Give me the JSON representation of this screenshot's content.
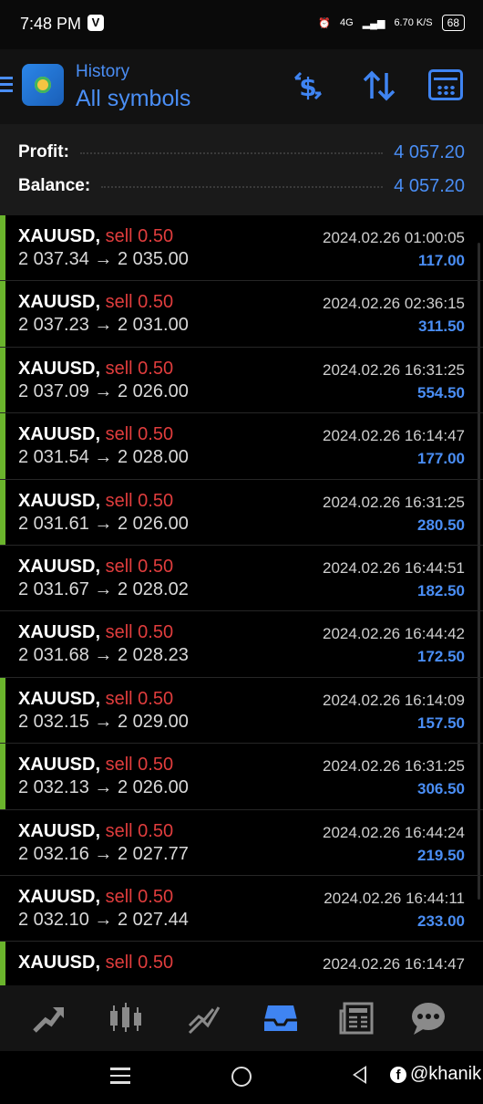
{
  "status_bar": {
    "time": "7:48 PM",
    "v_badge": "V",
    "network": "4G",
    "speed": "6.70 K/S",
    "battery": "68"
  },
  "header": {
    "subtitle": "History",
    "title": "All symbols",
    "accent_color": "#4a8ef5"
  },
  "summary": {
    "profit_label": "Profit:",
    "profit_value": "4 057.20",
    "balance_label": "Balance:",
    "balance_value": "4 057.20"
  },
  "deals": [
    {
      "symbol": "XAUUSD,",
      "type": "sell 0.50",
      "prices": "2 037.34 → 2 035.00",
      "date": "2024.02.26 01:00:05",
      "profit": "117.00",
      "marked": true
    },
    {
      "symbol": "XAUUSD,",
      "type": "sell 0.50",
      "prices": "2 037.23 → 2 031.00",
      "date": "2024.02.26 02:36:15",
      "profit": "311.50",
      "marked": true
    },
    {
      "symbol": "XAUUSD,",
      "type": "sell 0.50",
      "prices": "2 037.09 → 2 026.00",
      "date": "2024.02.26 16:31:25",
      "profit": "554.50",
      "marked": true
    },
    {
      "symbol": "XAUUSD,",
      "type": "sell 0.50",
      "prices": "2 031.54 → 2 028.00",
      "date": "2024.02.26 16:14:47",
      "profit": "177.00",
      "marked": true
    },
    {
      "symbol": "XAUUSD,",
      "type": "sell 0.50",
      "prices": "2 031.61 → 2 026.00",
      "date": "2024.02.26 16:31:25",
      "profit": "280.50",
      "marked": true
    },
    {
      "symbol": "XAUUSD,",
      "type": "sell 0.50",
      "prices": "2 031.67 → 2 028.02",
      "date": "2024.02.26 16:44:51",
      "profit": "182.50",
      "marked": false
    },
    {
      "symbol": "XAUUSD,",
      "type": "sell 0.50",
      "prices": "2 031.68 → 2 028.23",
      "date": "2024.02.26 16:44:42",
      "profit": "172.50",
      "marked": false
    },
    {
      "symbol": "XAUUSD,",
      "type": "sell 0.50",
      "prices": "2 032.15 → 2 029.00",
      "date": "2024.02.26 16:14:09",
      "profit": "157.50",
      "marked": true
    },
    {
      "symbol": "XAUUSD,",
      "type": "sell 0.50",
      "prices": "2 032.13 → 2 026.00",
      "date": "2024.02.26 16:31:25",
      "profit": "306.50",
      "marked": true
    },
    {
      "symbol": "XAUUSD,",
      "type": "sell 0.50",
      "prices": "2 032.16 → 2 027.77",
      "date": "2024.02.26 16:44:24",
      "profit": "219.50",
      "marked": false
    },
    {
      "symbol": "XAUUSD,",
      "type": "sell 0.50",
      "prices": "2 032.10 → 2 027.44",
      "date": "2024.02.26 16:44:11",
      "profit": "233.00",
      "marked": false
    },
    {
      "symbol": "XAUUSD,",
      "type": "sell 0.50",
      "prices": "",
      "date": "2024.02.26 16:14:47",
      "profit": "",
      "marked": true
    }
  ],
  "tabs": [
    {
      "name": "tab-trade",
      "icon": "trend-arrow-icon"
    },
    {
      "name": "tab-chart",
      "icon": "candlestick-icon"
    },
    {
      "name": "tab-quotes",
      "icon": "line-chart-icon"
    },
    {
      "name": "tab-history",
      "icon": "inbox-tray-icon",
      "active": true
    },
    {
      "name": "tab-news",
      "icon": "newspaper-icon"
    },
    {
      "name": "tab-messages",
      "icon": "chat-bubble-icon"
    }
  ],
  "watermark": {
    "icon": "f",
    "text": "@khanik"
  },
  "colors": {
    "sell": "#e03d3d",
    "profit": "#4a8ef5",
    "marker": "#6ab42c"
  }
}
